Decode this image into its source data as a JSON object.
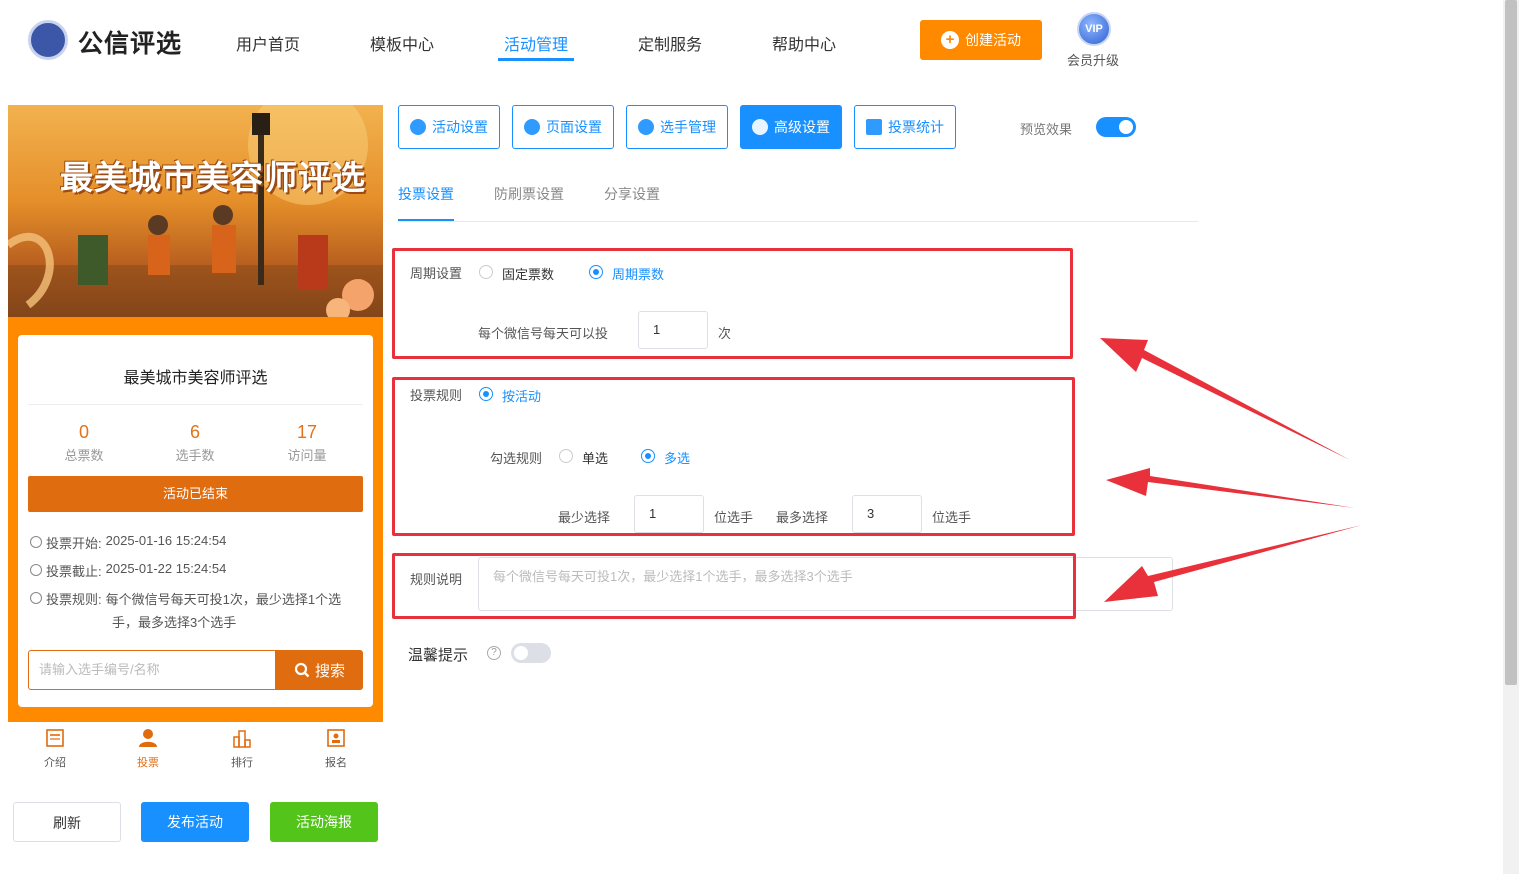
{
  "header": {
    "logo_text": "公信评选",
    "nav": [
      "用户首页",
      "模板中心",
      "活动管理",
      "定制服务",
      "帮助中心"
    ],
    "create_button": "创建活动",
    "vip_badge": "VIP",
    "vip_label": "会员升级"
  },
  "preview": {
    "banner_title": "最美城市美容师评选",
    "card_title": "最美城市美容师评选",
    "stats": [
      {
        "value": "0",
        "label": "总票数"
      },
      {
        "value": "6",
        "label": "选手数"
      },
      {
        "value": "17",
        "label": "访问量"
      }
    ],
    "status_button": "活动已结束",
    "vote_start_label": "投票开始:",
    "vote_start": "2025-01-16 15:24:54",
    "vote_end_label": "投票截止:",
    "vote_end": "2025-01-22 15:24:54",
    "rule_label": "投票规则:",
    "rule_line1": "每个微信号每天可投1次，最少选择1个选",
    "rule_line2": "手，最多选择3个选手",
    "search_placeholder": "请输入选手编号/名称",
    "search_button": "搜索",
    "tabs": [
      "介绍",
      "投票",
      "排行",
      "报名"
    ]
  },
  "actions": {
    "refresh": "刷新",
    "publish": "发布活动",
    "poster": "活动海报"
  },
  "settings": {
    "tabs": [
      "活动设置",
      "页面设置",
      "选手管理",
      "高级设置",
      "投票统计"
    ],
    "preview_label": "预览效果",
    "preview_enabled": true,
    "sub_tabs": [
      "投票设置",
      "防刷票设置",
      "分享设置"
    ],
    "cycle_label": "周期设置",
    "cycle_options": [
      "固定票数",
      "周期票数"
    ],
    "cycle_selected": "周期票数",
    "per_day_label": "每个微信号每天可以投",
    "per_day_value": "1",
    "per_day_unit": "次",
    "rule_label": "投票规则",
    "rule_option": "按活动",
    "check_rule_label": "勾选规则",
    "check_options": [
      "单选",
      "多选"
    ],
    "check_selected": "多选",
    "min_label": "最少选择",
    "min_value": "1",
    "min_unit": "位选手",
    "max_label": "最多选择",
    "max_value": "3",
    "max_unit": "位选手",
    "desc_label": "规则说明",
    "desc_placeholder": "每个微信号每天可投1次，最少选择1个选手，最多选择3个选手",
    "tip_label": "温馨提示",
    "tip_enabled": false
  },
  "colors": {
    "accent": "#1890ff",
    "orange": "#ff8a00",
    "highlight": "#e8313a"
  }
}
